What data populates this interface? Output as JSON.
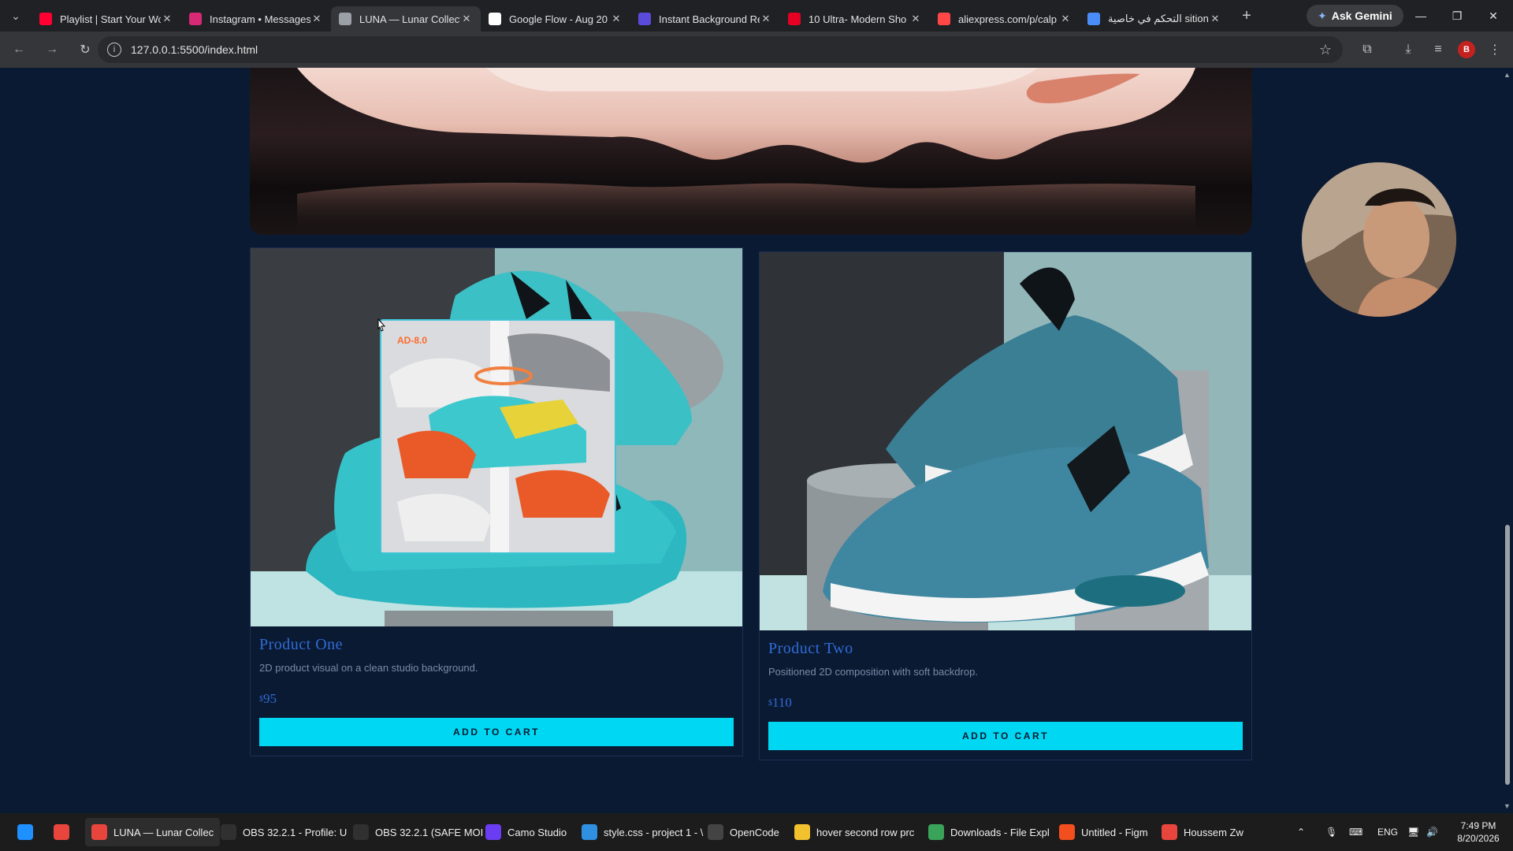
{
  "browser": {
    "tabs": [
      {
        "title": "Playlist | Start Your Wo",
        "favicon": "youtube-icon",
        "color": "#ff0033"
      },
      {
        "title": "Instagram • Messages",
        "favicon": "instagram-icon",
        "color": "#d62976"
      },
      {
        "title": "LUNA — Lunar Collect",
        "favicon": "globe-icon",
        "color": "#9aa0a6",
        "active": true
      },
      {
        "title": "Google Flow - Aug 20",
        "favicon": "document-icon",
        "color": "#ffffff"
      },
      {
        "title": "Instant Background Re",
        "favicon": "removebg-icon",
        "color": "#5b4bdb"
      },
      {
        "title": "10 Ultra- Modern Sho",
        "favicon": "pinterest-icon",
        "color": "#e60023"
      },
      {
        "title": "aliexpress.com/p/calp",
        "favicon": "aliexpress-icon",
        "color": "#ff4747"
      },
      {
        "title": "التحكم في خاصية sition",
        "favicon": "gemini-icon",
        "color": "#4b8df8"
      }
    ],
    "new_tab": "+",
    "ask_gemini": "Ask Gemini",
    "url": "127.0.0.1:5500/index.html",
    "profile_initial": "B"
  },
  "products": [
    {
      "name": "Product One",
      "description": "2D product visual on a clean studio background.",
      "currency": "$",
      "price": "95",
      "button": "ADD TO CART"
    },
    {
      "name": "Product Two",
      "description": "Positioned 2D composition with soft backdrop.",
      "currency": "$",
      "price": "110",
      "button": "ADD TO CART"
    }
  ],
  "preview_tag": "AD-8.0",
  "taskbar": {
    "items": [
      {
        "label": "",
        "icon": "windows-start-icon",
        "color": "#1e90ff"
      },
      {
        "label": "",
        "icon": "chrome-icon",
        "color": "#e8453c"
      },
      {
        "label": "LUNA — Lunar Collec",
        "icon": "chrome-icon",
        "color": "#e8453c",
        "active": true
      },
      {
        "label": "OBS 32.2.1 - Profile: U",
        "icon": "obs-icon",
        "color": "#303030"
      },
      {
        "label": "OBS 32.2.1 (SAFE MOI",
        "icon": "obs-icon",
        "color": "#303030"
      },
      {
        "label": "Camo Studio",
        "icon": "camo-icon",
        "color": "#6a3df2"
      },
      {
        "label": "style.css - project 1 - \\",
        "icon": "vscode-icon",
        "color": "#2f8fe0"
      },
      {
        "label": "OpenCode",
        "icon": "terminal-icon",
        "color": "#444444"
      },
      {
        "label": "hover second row prc",
        "icon": "folder-icon",
        "color": "#f2c12e"
      },
      {
        "label": "Downloads - File Expl",
        "icon": "download-icon",
        "color": "#3aa35a"
      },
      {
        "label": "Untitled - Figm",
        "icon": "figma-icon",
        "color": "#f24e1e"
      },
      {
        "label": "Houssem Zw",
        "icon": "chrome-icon",
        "color": "#e8453c"
      }
    ],
    "language": "ENG",
    "time": "7:49 PM",
    "date": "8/20/2026"
  }
}
